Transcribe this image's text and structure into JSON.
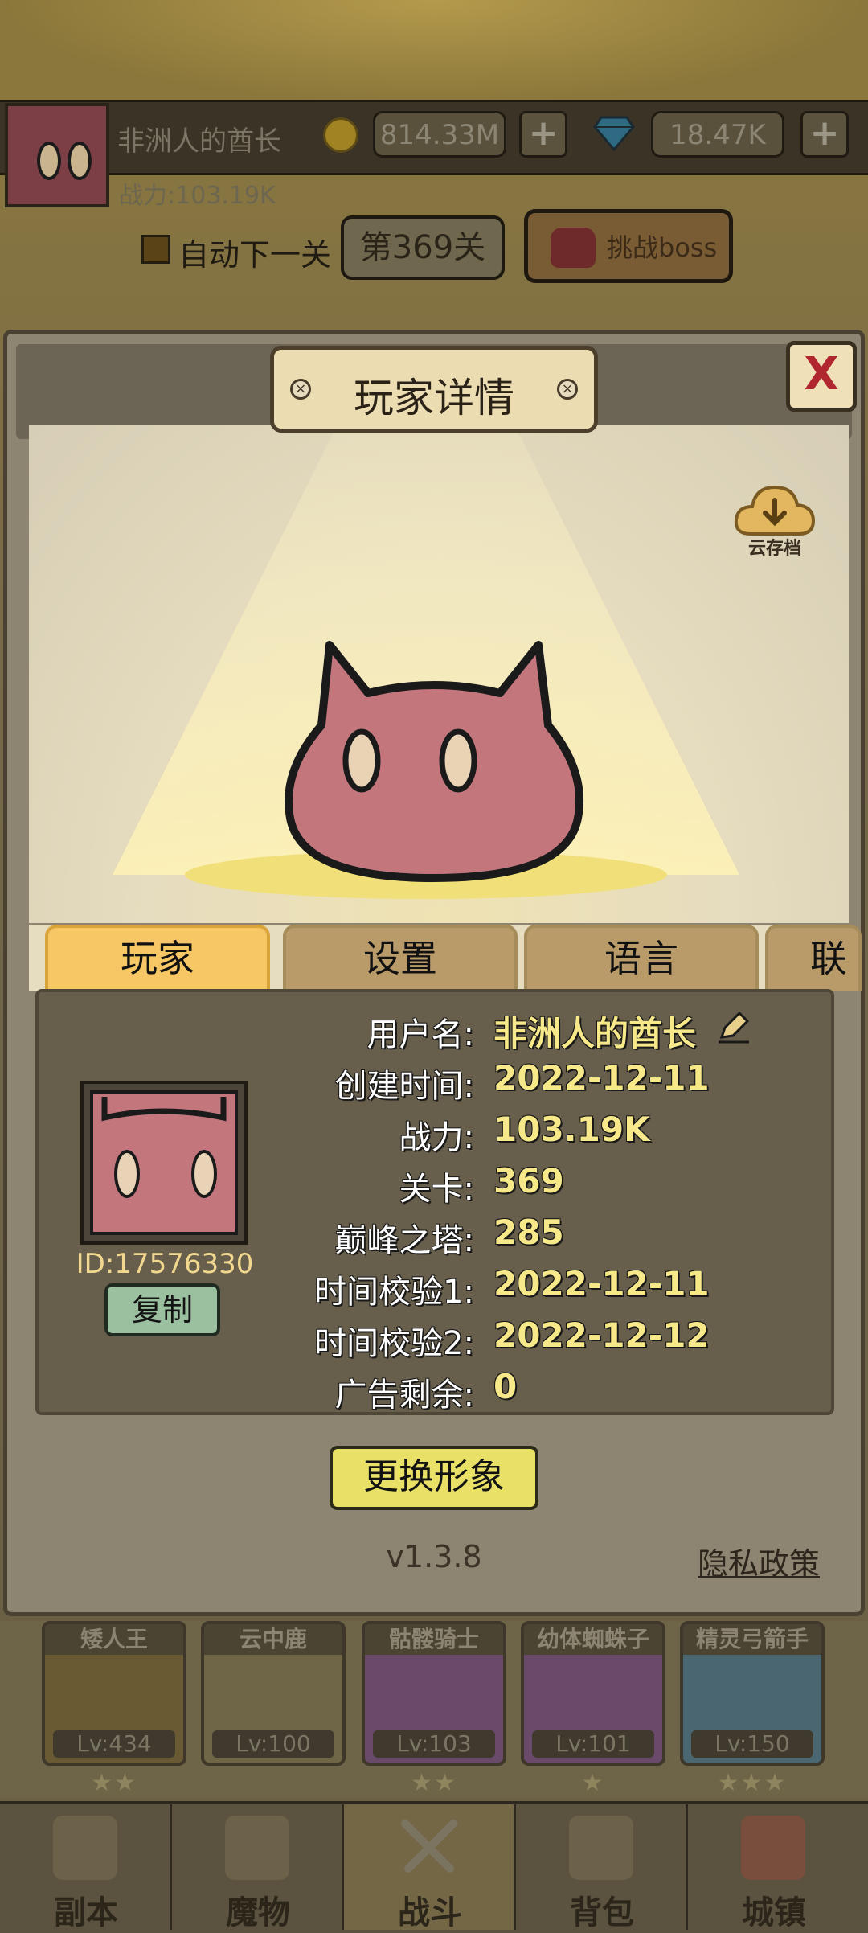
{
  "top_bar": {
    "player_name": "非洲人的酋长",
    "gold": "814.33M",
    "gems": "18.47K",
    "plus": "+",
    "power": "战力:103.19K",
    "auto_next_label": "自动下一关",
    "level_label": "第369关",
    "boss_label": "挑战boss"
  },
  "modal": {
    "title": "玩家详情",
    "close": "X",
    "cloud_save_label": "云存档",
    "tabs": [
      {
        "label": "玩家",
        "active": true
      },
      {
        "label": "设置",
        "active": false
      },
      {
        "label": "语言",
        "active": false
      },
      {
        "label": "联",
        "active": false
      }
    ],
    "player_id": "ID:17576330",
    "copy_button": "复制",
    "rows": [
      {
        "label": "用户名:",
        "value": "非洲人的酋长"
      },
      {
        "label": "创建时间:",
        "value": "2022-12-11"
      },
      {
        "label": "战力:",
        "value": "103.19K"
      },
      {
        "label": "关卡:",
        "value": "369"
      },
      {
        "label": "巅峰之塔:",
        "value": "285"
      },
      {
        "label": "时间校验1:",
        "value": "2022-12-11"
      },
      {
        "label": "时间校验2:",
        "value": "2022-12-12"
      },
      {
        "label": "广告剩余:",
        "value": "0"
      }
    ],
    "change_avatar_button": "更换形象",
    "version": "v1.3.8",
    "privacy_link": "隐私政策"
  },
  "heroes": [
    {
      "name": "矮人王",
      "level": "Lv:434",
      "stars": "★★",
      "color": "#6a5a34"
    },
    {
      "name": "云中鹿",
      "level": "Lv:100",
      "stars": "",
      "color": "#6f6547"
    },
    {
      "name": "骷髅骑士",
      "level": "Lv:103",
      "stars": "★★",
      "color": "#6a4a6a"
    },
    {
      "name": "幼体蜘蛛子",
      "level": "Lv:101",
      "stars": "★",
      "color": "#6a4a6a"
    },
    {
      "name": "精灵弓箭手",
      "level": "Lv:150",
      "stars": "★★★",
      "color": "#4a6670"
    }
  ],
  "nav": [
    {
      "label": "副本",
      "icon": "map-icon",
      "active": false
    },
    {
      "label": "魔物",
      "icon": "monster-icon",
      "active": false
    },
    {
      "label": "战斗",
      "icon": "crossed-swords-icon",
      "active": true
    },
    {
      "label": "背包",
      "icon": "backpack-icon",
      "active": false
    },
    {
      "label": "城镇",
      "icon": "shop-icon",
      "active": false
    }
  ],
  "colors": {
    "accent_tab": "#f6c764",
    "value_text": "#f7e88a",
    "avatar_pink": "#c3777c",
    "close_red": "#b0272f"
  }
}
